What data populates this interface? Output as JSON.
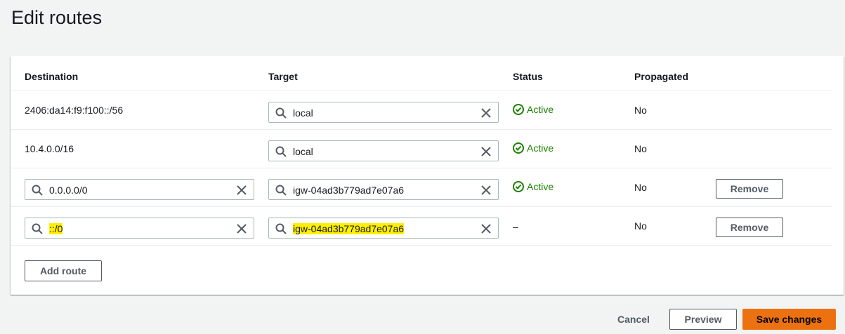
{
  "page": {
    "title": "Edit routes"
  },
  "table": {
    "headers": {
      "destination": "Destination",
      "target": "Target",
      "status": "Status",
      "propagated": "Propagated"
    },
    "rows": [
      {
        "destination": "2406:da14:f9:f100::/56",
        "target": "local",
        "status": "Active",
        "propagated": "No"
      },
      {
        "destination": "10.4.0.0/16",
        "target": "local",
        "status": "Active",
        "propagated": "No"
      },
      {
        "destination": "0.0.0.0/0",
        "target": "igw-04ad3b779ad7e07a6",
        "status": "Active",
        "propagated": "No",
        "remove": "Remove"
      },
      {
        "destination": "::/0",
        "target": "igw-04ad3b779ad7e07a6",
        "status": "–",
        "propagated": "No",
        "remove": "Remove"
      }
    ],
    "add_route": "Add route"
  },
  "footer": {
    "cancel": "Cancel",
    "preview": "Preview",
    "save": "Save changes"
  },
  "colors": {
    "status_active": "#1d8102",
    "primary": "#ec7211",
    "highlight": "#ffef00"
  }
}
